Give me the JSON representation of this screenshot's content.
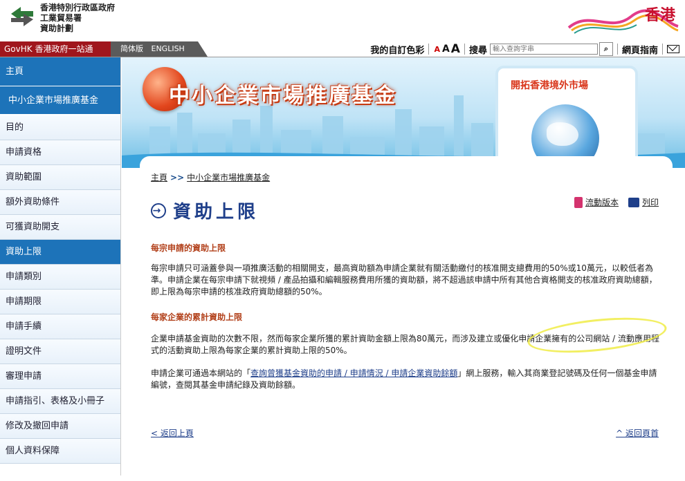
{
  "header": {
    "org_lines": [
      "香港特別行政區政府",
      "工業貿易署",
      "資助計劃"
    ],
    "brand_text": "香港"
  },
  "topbar": {
    "govhk_label": "GovHK 香港政府一站通",
    "lang_simplified": "简体版",
    "lang_english": "ENGLISH",
    "custom_colour": "我的自訂色彩",
    "font_sizes": [
      "A",
      "A",
      "A"
    ],
    "search_label": "搜尋",
    "search_placeholder": "輸入查詢字串",
    "page_guide": "網頁指南"
  },
  "sidebar": {
    "items": [
      {
        "label": "主頁"
      },
      {
        "label": "中小企業市場推廣基金"
      },
      {
        "label": "目的"
      },
      {
        "label": "申請資格"
      },
      {
        "label": "資助範圍"
      },
      {
        "label": "額外資助條件"
      },
      {
        "label": "可獲資助開支"
      },
      {
        "label": "資助上限"
      },
      {
        "label": "申請類別"
      },
      {
        "label": "申請期限"
      },
      {
        "label": "申請手續"
      },
      {
        "label": "證明文件"
      },
      {
        "label": "審理申請"
      },
      {
        "label": "申請指引、表格及小冊子"
      },
      {
        "label": "修改及撤回申請"
      },
      {
        "label": "個人資料保障"
      }
    ]
  },
  "banner": {
    "title": "中小企業市場推廣基金",
    "promo_title": "開拓香港境外市場"
  },
  "content": {
    "breadcrumb_home": "主頁",
    "breadcrumb_sep": ">>",
    "breadcrumb_current": "中小企業市場推廣基金",
    "page_title": "資助上限",
    "mobile_version": "流動版本",
    "print": "列印",
    "section1_heading": "每宗申請的資助上限",
    "section1_text": "每宗申請只可涵蓋參與一項推廣活動的相關開支，最高資助額為申請企業就有關活動繳付的核准開支總費用的50%或10萬元，以較低者為準。申請企業在每宗申請下就視頻 / 產品拍攝和編輯服務費用所獲的資助額，將不超過該申請中所有其他合資格開支的核准政府資助總額，即上限為每宗申請的核准政府資助總額的50%。",
    "section2_heading": "每家企業的累計資助上限",
    "section2_text": "企業申請基金資助的次數不限，然而每家企業所獲的累計資助金額上限為80萬元，而涉及建立或優化申請企業擁有的公司網站 / 流動應用程式的活動資助上限為每家企業的累計資助上限的50%。",
    "section3_prefix": "申請企業可通過本網站的「",
    "section3_link": "查詢曾獲基金資助的申請 / 申請情況 / 申請企業資助餘額",
    "section3_suffix": "」網上服務，輸入其商業登記號碼及任何一個基金申請編號，查閱其基金申請紀錄及資助餘額。",
    "back_prev": "< 返回上頁",
    "back_top": "^ 返回頁首"
  },
  "colors": {
    "nav_blue": "#1d73b9",
    "govhk_red": "#a0161d",
    "heading_orange": "#b2401a",
    "title_blue": "#1f3f8a"
  }
}
